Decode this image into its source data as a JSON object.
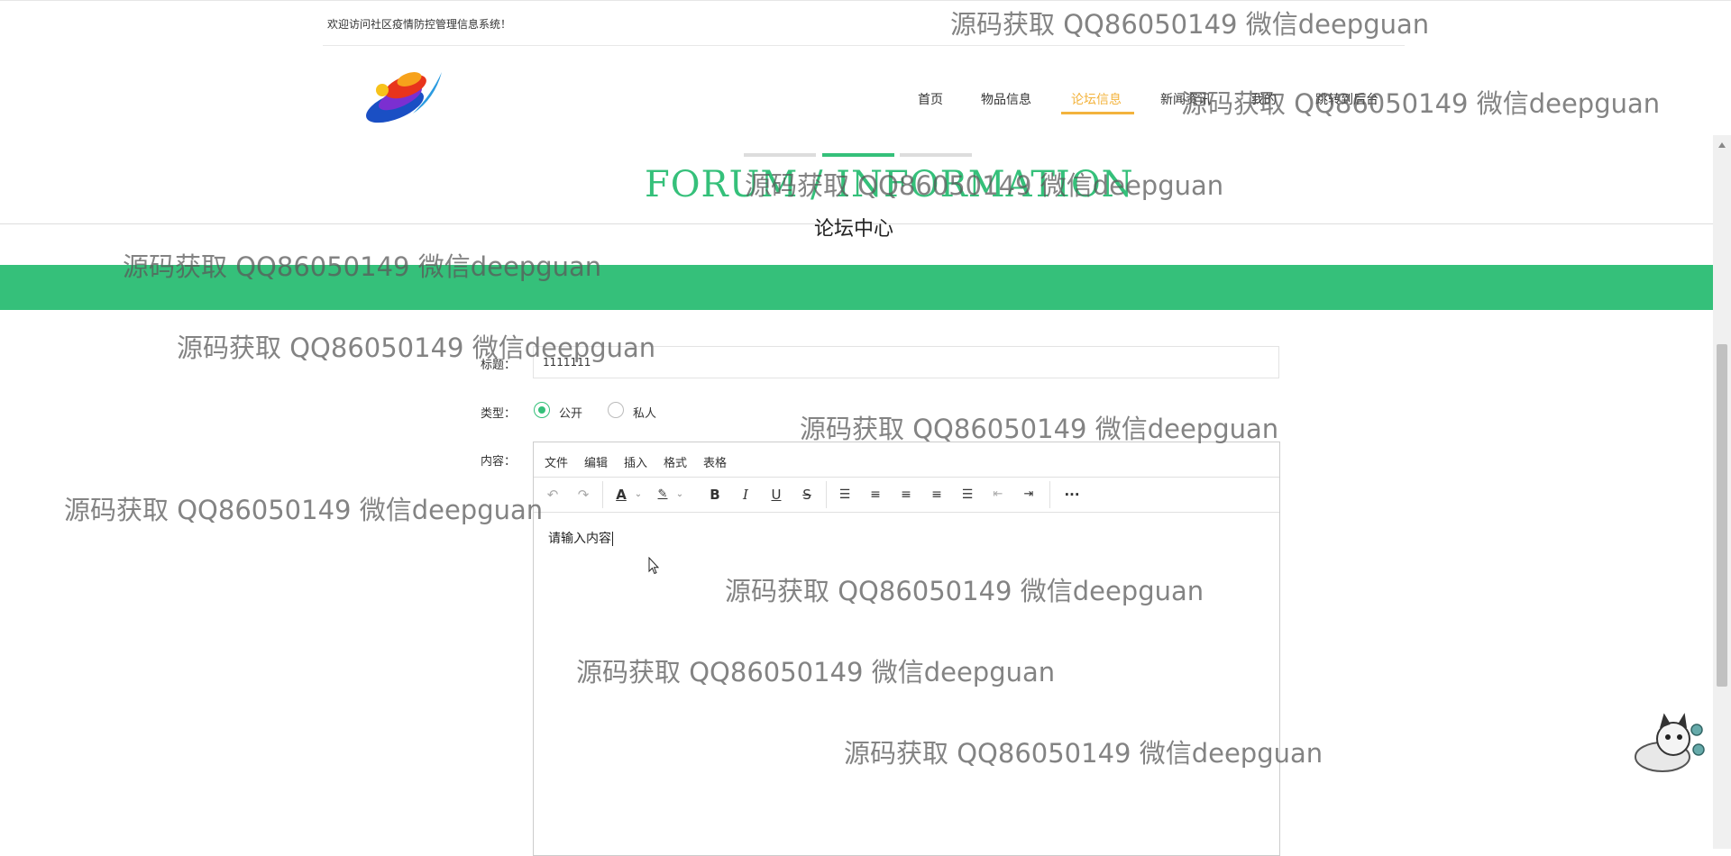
{
  "header": {
    "welcome": "欢迎访问社区疫情防控管理信息系统！"
  },
  "nav": {
    "items": [
      {
        "label": "首页",
        "active": false
      },
      {
        "label": "物品信息",
        "active": false
      },
      {
        "label": "论坛信息",
        "active": true
      },
      {
        "label": "新闻资讯",
        "active": false
      },
      {
        "label": "我的",
        "active": false
      },
      {
        "label": "跳转到后台",
        "active": false
      }
    ]
  },
  "section": {
    "title_en": "FORUM / INFORMATION",
    "title_cn": "论坛中心"
  },
  "form": {
    "title_label": "标题：",
    "title_value": "1111111",
    "type_label": "类型：",
    "type_options": [
      {
        "label": "公开",
        "checked": true
      },
      {
        "label": "私人",
        "checked": false
      }
    ],
    "content_label": "内容："
  },
  "editor": {
    "menu": [
      "文件",
      "编辑",
      "插入",
      "格式",
      "表格"
    ],
    "toolbar_icons": [
      "undo-icon",
      "redo-icon",
      "text-color-icon",
      "highlight-color-icon",
      "bold-icon",
      "italic-icon",
      "underline-icon",
      "strikethrough-icon",
      "bullet-list-icon",
      "align-left-icon",
      "align-center-icon",
      "align-right-icon",
      "align-justify-icon",
      "outdent-icon",
      "indent-icon",
      "more-icon"
    ],
    "content": "请输入内容"
  },
  "watermark": "源码获取 QQ86050149 微信deepguan",
  "colors": {
    "accent_green": "#35c07a",
    "nav_active": "#f3b33d"
  }
}
